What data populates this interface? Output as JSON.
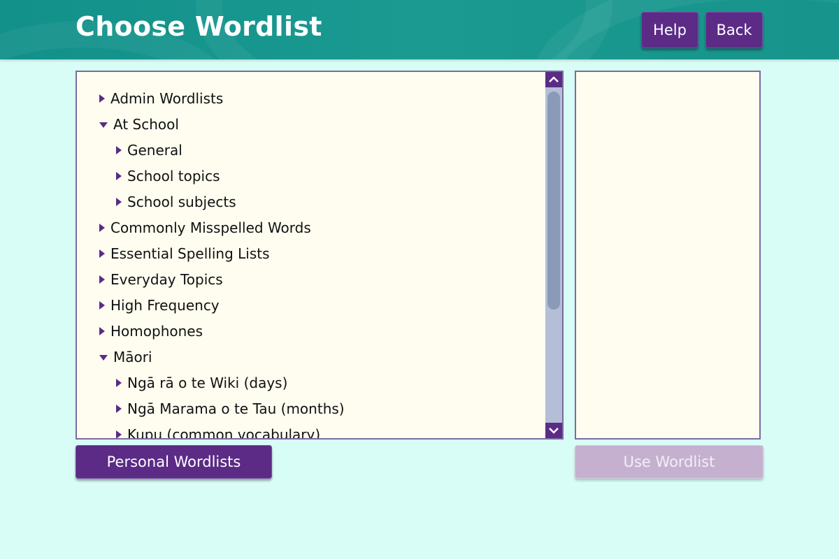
{
  "header": {
    "title": "Choose Wordlist",
    "help_label": "Help",
    "back_label": "Back"
  },
  "tree": {
    "items": [
      {
        "label": "Admin Wordlists",
        "expanded": false,
        "level": 0
      },
      {
        "label": "At School",
        "expanded": true,
        "level": 0
      },
      {
        "label": "General",
        "expanded": false,
        "level": 1
      },
      {
        "label": "School topics",
        "expanded": false,
        "level": 1
      },
      {
        "label": "School subjects",
        "expanded": false,
        "level": 1
      },
      {
        "label": "Commonly Misspelled Words",
        "expanded": false,
        "level": 0
      },
      {
        "label": "Essential Spelling Lists",
        "expanded": false,
        "level": 0
      },
      {
        "label": "Everyday Topics",
        "expanded": false,
        "level": 0
      },
      {
        "label": "High Frequency",
        "expanded": false,
        "level": 0
      },
      {
        "label": "Homophones",
        "expanded": false,
        "level": 0
      },
      {
        "label": "Māori",
        "expanded": true,
        "level": 0
      },
      {
        "label": "Ngā rā o te Wiki (days)",
        "expanded": false,
        "level": 1
      },
      {
        "label": "Ngā Marama o te Tau (months)",
        "expanded": false,
        "level": 1
      },
      {
        "label": "Kupu (common vocabulary)",
        "expanded": false,
        "level": 1
      }
    ]
  },
  "buttons": {
    "personal_label": "Personal Wordlists",
    "use_label": "Use Wordlist"
  },
  "colors": {
    "accent": "#5b2b86",
    "header": "#1a9a91",
    "background": "#d8fcf6",
    "panel": "#fefdf0",
    "disabled": "#c5b1cf"
  },
  "icons": {
    "collapsed": "triangle-right-icon",
    "expanded": "triangle-down-icon",
    "scroll_up": "chevron-up-icon",
    "scroll_down": "chevron-down-icon"
  }
}
